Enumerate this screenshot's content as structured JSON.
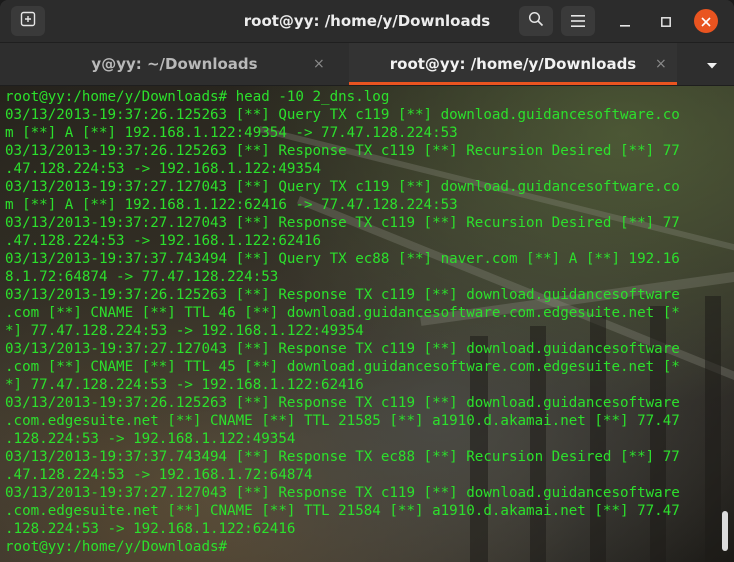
{
  "window": {
    "title": "root@yy: /home/y/Downloads",
    "accent": "#e95420",
    "text_color": "#2ce02c"
  },
  "header": {
    "new_tab_icon": "new-tab-icon",
    "search_icon": "search-icon",
    "menu_icon": "hamburger-menu-icon",
    "minimize_icon": "minimize-icon",
    "maximize_icon": "maximize-icon",
    "close_icon": "close-icon"
  },
  "tabs": [
    {
      "label": "y@yy: ~/Downloads",
      "active": false,
      "close_glyph": "×"
    },
    {
      "label": "root@yy: /home/y/Downloads",
      "active": true,
      "close_glyph": "×"
    }
  ],
  "terminal": {
    "lines": [
      "root@yy:/home/y/Downloads# head -10 2_dns.log",
      "03/13/2013-19:37:26.125263 [**] Query TX c119 [**] download.guidancesoftware.co",
      "m [**] A [**] 192.168.1.122:49354 -> 77.47.128.224:53",
      "03/13/2013-19:37:26.125263 [**] Response TX c119 [**] Recursion Desired [**] 77",
      ".47.128.224:53 -> 192.168.1.122:49354",
      "03/13/2013-19:37:27.127043 [**] Query TX c119 [**] download.guidancesoftware.co",
      "m [**] A [**] 192.168.1.122:62416 -> 77.47.128.224:53",
      "03/13/2013-19:37:27.127043 [**] Response TX c119 [**] Recursion Desired [**] 77",
      ".47.128.224:53 -> 192.168.1.122:62416",
      "03/13/2013-19:37:37.743494 [**] Query TX ec88 [**] naver.com [**] A [**] 192.16",
      "8.1.72:64874 -> 77.47.128.224:53",
      "03/13/2013-19:37:26.125263 [**] Response TX c119 [**] download.guidancesoftware",
      ".com [**] CNAME [**] TTL 46 [**] download.guidancesoftware.com.edgesuite.net [*",
      "*] 77.47.128.224:53 -> 192.168.1.122:49354",
      "03/13/2013-19:37:27.127043 [**] Response TX c119 [**] download.guidancesoftware",
      ".com [**] CNAME [**] TTL 45 [**] download.guidancesoftware.com.edgesuite.net [*",
      "*] 77.47.128.224:53 -> 192.168.1.122:62416",
      "03/13/2013-19:37:26.125263 [**] Response TX c119 [**] download.guidancesoftware",
      ".com.edgesuite.net [**] CNAME [**] TTL 21585 [**] a1910.d.akamai.net [**] 77.47",
      ".128.224:53 -> 192.168.1.122:49354",
      "03/13/2013-19:37:37.743494 [**] Response TX ec88 [**] Recursion Desired [**] 77",
      ".47.128.224:53 -> 192.168.1.72:64874",
      "03/13/2013-19:37:27.127043 [**] Response TX c119 [**] download.guidancesoftware",
      ".com.edgesuite.net [**] CNAME [**] TTL 21584 [**] a1910.d.akamai.net [**] 77.47",
      ".128.224:53 -> 192.168.1.122:62416",
      "root@yy:/home/y/Downloads# "
    ]
  }
}
